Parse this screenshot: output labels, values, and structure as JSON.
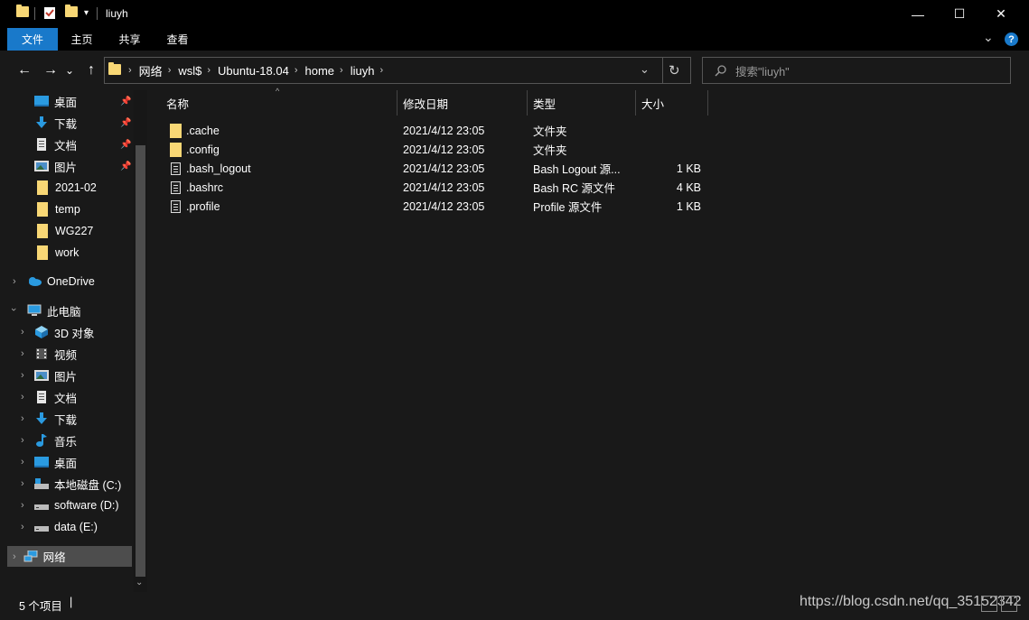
{
  "window": {
    "title": "liuyh",
    "minimize": "—",
    "maximize": "☐",
    "close": "✕"
  },
  "ribbon": {
    "tabs": [
      "文件",
      "主页",
      "共享",
      "查看"
    ],
    "expand": "⌄",
    "help": "?"
  },
  "nav": {
    "back": "←",
    "forward": "→",
    "recent": "⌄",
    "up": "↑",
    "breadcrumb": [
      "网络",
      "wsl$",
      "Ubuntu-18.04",
      "home",
      "liuyh"
    ],
    "history_dropdown": "⌄",
    "refresh": "↻"
  },
  "search": {
    "placeholder": "搜索\"liuyh\""
  },
  "sidebar": {
    "quick_access": [
      {
        "label": "桌面",
        "icon": "desktop-icon",
        "pinned": true
      },
      {
        "label": "下载",
        "icon": "download-icon",
        "pinned": true
      },
      {
        "label": "文档",
        "icon": "document-icon",
        "pinned": true
      },
      {
        "label": "图片",
        "icon": "picture-icon",
        "pinned": true
      },
      {
        "label": "2021-02",
        "icon": "folder-icon",
        "pinned": false
      },
      {
        "label": "temp",
        "icon": "folder-icon",
        "pinned": false
      },
      {
        "label": "WG227",
        "icon": "folder-icon",
        "pinned": false
      },
      {
        "label": "work",
        "icon": "folder-icon",
        "pinned": false
      }
    ],
    "onedrive": "OneDrive",
    "this_pc": "此电脑",
    "pc_items": [
      {
        "label": "3D 对象",
        "icon": "3d-objects-icon"
      },
      {
        "label": "视频",
        "icon": "video-icon"
      },
      {
        "label": "图片",
        "icon": "picture-icon"
      },
      {
        "label": "文档",
        "icon": "document-icon"
      },
      {
        "label": "下载",
        "icon": "download-icon"
      },
      {
        "label": "音乐",
        "icon": "music-icon"
      },
      {
        "label": "桌面",
        "icon": "desktop-icon"
      },
      {
        "label": "本地磁盘 (C:)",
        "icon": "drive-c-icon"
      },
      {
        "label": "software (D:)",
        "icon": "drive-icon"
      },
      {
        "label": "data (E:)",
        "icon": "drive-icon"
      }
    ],
    "network": "网络"
  },
  "columns": {
    "name": "名称",
    "modified": "修改日期",
    "type": "类型",
    "size": "大小"
  },
  "files": [
    {
      "name": ".cache",
      "modified": "2021/4/12 23:05",
      "type": "文件夹",
      "size": "",
      "kind": "folder"
    },
    {
      "name": ".config",
      "modified": "2021/4/12 23:05",
      "type": "文件夹",
      "size": "",
      "kind": "folder"
    },
    {
      "name": ".bash_logout",
      "modified": "2021/4/12 23:05",
      "type": "Bash Logout 源...",
      "size": "1 KB",
      "kind": "file"
    },
    {
      "name": ".bashrc",
      "modified": "2021/4/12 23:05",
      "type": "Bash RC 源文件",
      "size": "4 KB",
      "kind": "file"
    },
    {
      "name": ".profile",
      "modified": "2021/4/12 23:05",
      "type": "Profile 源文件",
      "size": "1 KB",
      "kind": "file"
    }
  ],
  "status": {
    "count": "5 个项目",
    "divider": "|"
  },
  "watermark": "https://blog.csdn.net/qq_35152342",
  "colors": {
    "accent": "#1979ca",
    "folder": "#f8d775",
    "background": "#191919",
    "selection": "#4d4d4d"
  }
}
